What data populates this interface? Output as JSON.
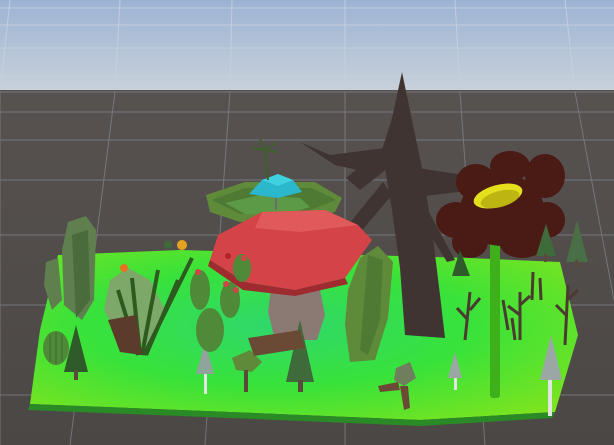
{
  "viewport": {
    "kind": "3D scene view",
    "sky_color_top": "#9bb3d4",
    "sky_color_bottom": "#c8d2dc",
    "ground_color": "#4f4b49",
    "grid_color": "#8c9bb0"
  },
  "scene": {
    "objects": [
      {
        "name": "terrain-platform",
        "color": "#37e03a"
      },
      {
        "name": "giant-mushroom",
        "cap_color": "#d44347",
        "stem_color": "#8a7a73"
      },
      {
        "name": "treehouse-platform",
        "color": "#5e8a3a"
      },
      {
        "name": "blue-umbrella",
        "color": "#2bb7cc"
      },
      {
        "name": "dead-tree",
        "color": "#3f3431"
      },
      {
        "name": "dark-flower",
        "petal_color": "#4a1a14",
        "center_color": "#e5e01e",
        "stem_color": "#3db01b"
      },
      {
        "name": "cactus",
        "color": "#4f8a39"
      },
      {
        "name": "pine-tree",
        "color": "#3f6a3a"
      },
      {
        "name": "bush-leaf",
        "color": "#5e8a3a"
      }
    ]
  }
}
